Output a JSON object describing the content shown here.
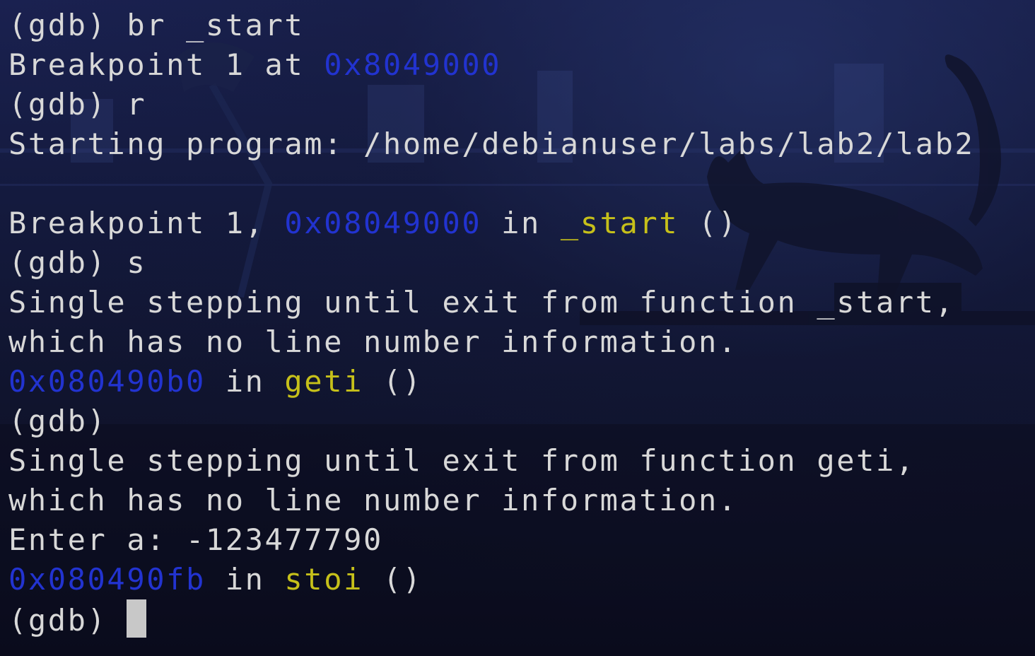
{
  "colors": {
    "text": "#d8d8d8",
    "address": "#2233d0",
    "function": "#c6c01a",
    "cursor": "#c8c8c8"
  },
  "lines": [
    {
      "segments": [
        {
          "text": "(gdb) br _start"
        }
      ]
    },
    {
      "segments": [
        {
          "text": "Breakpoint 1 at "
        },
        {
          "text": "0x8049000",
          "kind": "address"
        }
      ]
    },
    {
      "segments": [
        {
          "text": "(gdb) r"
        }
      ]
    },
    {
      "segments": [
        {
          "text": "Starting program: /home/debianuser/labs/lab2/lab2"
        }
      ]
    },
    {
      "segments": [
        {
          "text": ""
        }
      ]
    },
    {
      "segments": [
        {
          "text": "Breakpoint 1, "
        },
        {
          "text": "0x08049000",
          "kind": "address"
        },
        {
          "text": " in "
        },
        {
          "text": "_start",
          "kind": "function"
        },
        {
          "text": " ()"
        }
      ]
    },
    {
      "segments": [
        {
          "text": "(gdb) s"
        }
      ]
    },
    {
      "segments": [
        {
          "text": "Single stepping until exit from function _start,"
        }
      ]
    },
    {
      "segments": [
        {
          "text": "which has no line number information."
        }
      ]
    },
    {
      "segments": [
        {
          "text": "0x080490b0",
          "kind": "address"
        },
        {
          "text": " in "
        },
        {
          "text": "geti",
          "kind": "function"
        },
        {
          "text": " ()"
        }
      ]
    },
    {
      "segments": [
        {
          "text": "(gdb)"
        }
      ]
    },
    {
      "segments": [
        {
          "text": "Single stepping until exit from function geti,"
        }
      ]
    },
    {
      "segments": [
        {
          "text": "which has no line number information."
        }
      ]
    },
    {
      "segments": [
        {
          "text": "Enter a: -123477790"
        }
      ]
    },
    {
      "segments": [
        {
          "text": "0x080490fb",
          "kind": "address"
        },
        {
          "text": " in "
        },
        {
          "text": "stoi",
          "kind": "function"
        },
        {
          "text": " ()"
        }
      ]
    }
  ],
  "prompt": {
    "text": "(gdb) ",
    "input_value": ""
  }
}
